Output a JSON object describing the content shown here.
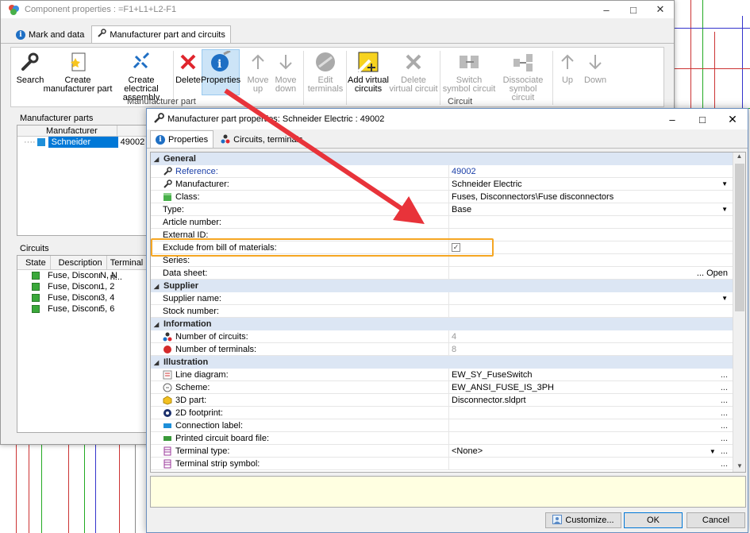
{
  "back_window": {
    "title": "Component properties : =F1+L1+L2-F1",
    "tabs": [
      {
        "label": "Mark and data"
      },
      {
        "label": "Manufacturer part and circuits"
      }
    ],
    "ribbon": {
      "buttons": {
        "search": "Search",
        "create_mp": "Create manufacturer part",
        "create_ea": "Create electrical assembly",
        "delete": "Delete",
        "properties": "Properties",
        "move_up": "Move up",
        "move_down": "Move down",
        "edit_terminals": "Edit terminals",
        "add_virtual": "Add virtual circuits",
        "delete_virtual": "Delete virtual circuit",
        "switch_symbol": "Switch symbol circuit",
        "dissociate": "Dissociate symbol circuit",
        "up": "Up",
        "down": "Down"
      },
      "groups": {
        "manufacturer_part": "Manufacturer part",
        "circuit": "Circuit"
      }
    },
    "manufacturer_parts": {
      "title": "Manufacturer parts",
      "column": "Manufacturer",
      "row_manufacturer": "Schneider Electric",
      "row_ref": "49002"
    },
    "circuits": {
      "title": "Circuits",
      "columns": [
        "State",
        "Description",
        "Terminal n..."
      ],
      "rows": [
        {
          "description": "Fuse, Disconn...",
          "terminals": "N, N"
        },
        {
          "description": "Fuse, Disconn...",
          "terminals": "1, 2"
        },
        {
          "description": "Fuse, Disconn...",
          "terminals": "3, 4"
        },
        {
          "description": "Fuse, Disconn...",
          "terminals": "5, 6"
        }
      ]
    }
  },
  "dialog": {
    "title": "Manufacturer part properties: Schneider Electric : 49002",
    "tabs": [
      {
        "label": "Properties"
      },
      {
        "label": "Circuits, terminals"
      }
    ],
    "sections": {
      "general": "General",
      "supplier": "Supplier",
      "information": "Information",
      "illustration": "Illustration"
    },
    "rows": {
      "reference": {
        "name": "Reference:",
        "value": "49002"
      },
      "manufacturer": {
        "name": "Manufacturer:",
        "value": "Schneider Electric"
      },
      "class": {
        "name": "Class:",
        "value": "Fuses, Disconnectors\\Fuse disconnectors"
      },
      "type": {
        "name": "Type:",
        "value": "Base"
      },
      "article": {
        "name": "Article number:",
        "value": ""
      },
      "external": {
        "name": "External ID:",
        "value": ""
      },
      "exclude": {
        "name": "Exclude from bill of materials:",
        "checked": true
      },
      "series": {
        "name": "Series:",
        "value": ""
      },
      "datasheet": {
        "name": "Data sheet:",
        "value": "... Open"
      },
      "supplier_name": {
        "name": "Supplier name:",
        "value": ""
      },
      "stock": {
        "name": "Stock number:",
        "value": ""
      },
      "num_circuits": {
        "name": "Number of circuits:",
        "value": "4"
      },
      "num_terminals": {
        "name": "Number of terminals:",
        "value": "8"
      },
      "line_diagram": {
        "name": "Line diagram:",
        "value": "EW_SY_FuseSwitch"
      },
      "scheme": {
        "name": "Scheme:",
        "value": "EW_ANSI_FUSE_IS_3PH"
      },
      "part3d": {
        "name": "3D part:",
        "value": "Disconnector.sldprt"
      },
      "footprint": {
        "name": "2D footprint:",
        "value": ""
      },
      "conn_label": {
        "name": "Connection label:",
        "value": ""
      },
      "pcb": {
        "name": "Printed circuit board file:",
        "value": ""
      },
      "terminal_type": {
        "name": "Terminal type:",
        "value": "<None>"
      },
      "terminal_strip": {
        "name": "Terminal strip symbol:",
        "value": ""
      }
    },
    "buttons": {
      "customize": "Customize...",
      "ok": "OK",
      "cancel": "Cancel"
    }
  },
  "colors": {
    "arrow": "#e8333a",
    "highlight": "#f5a623",
    "selection": "#0078d7"
  }
}
